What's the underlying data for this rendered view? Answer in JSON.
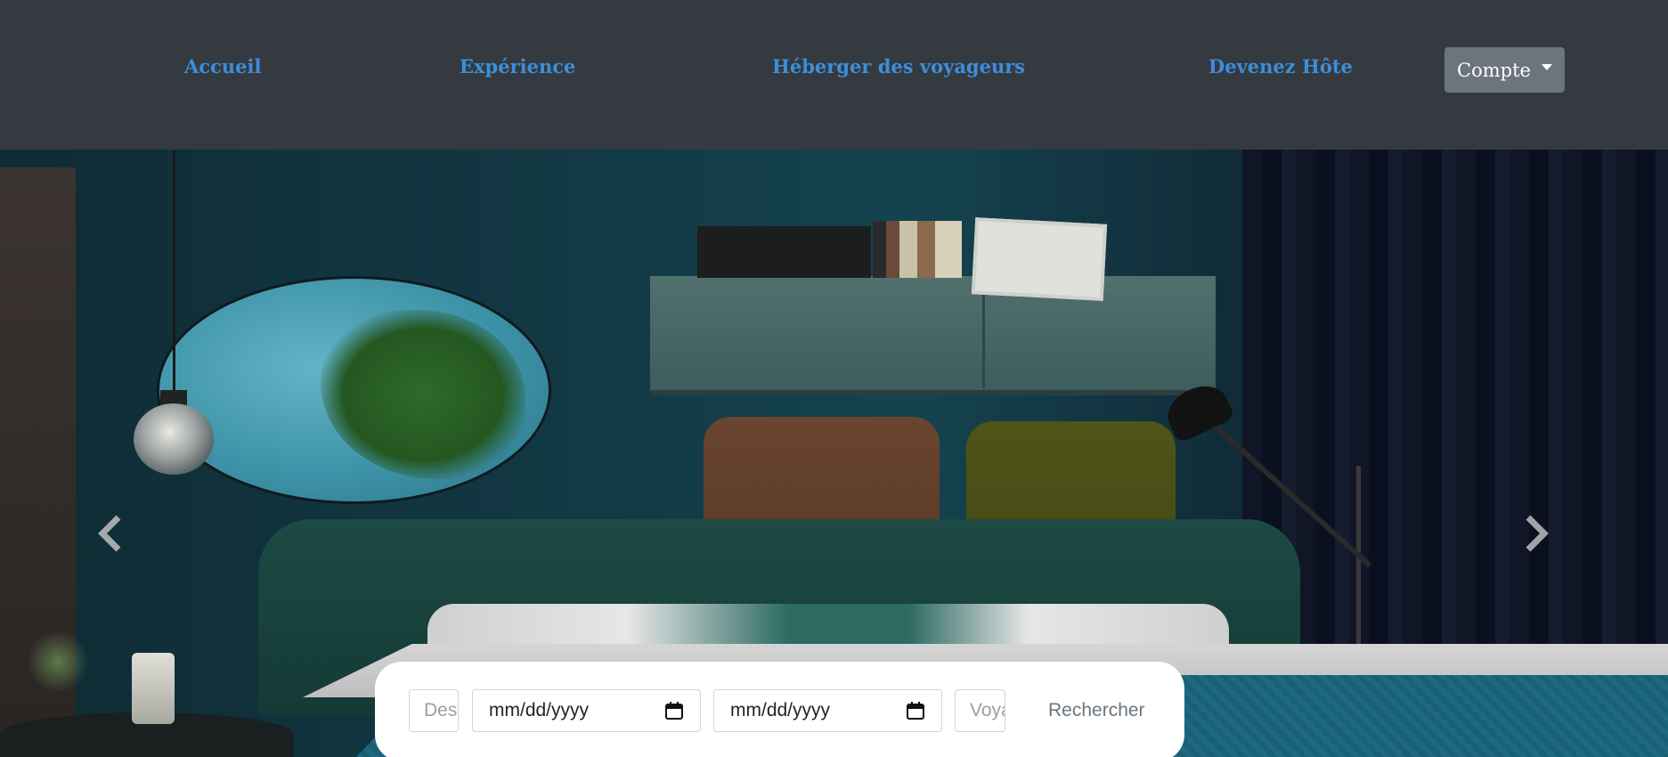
{
  "navbar": {
    "links": [
      {
        "label": "Accueil"
      },
      {
        "label": "Expérience"
      },
      {
        "label": "Héberger des voyageurs"
      },
      {
        "label": "Devenez Hôte"
      }
    ],
    "account_label": "Compte"
  },
  "hero": {
    "carousel": {
      "prev_icon": "chevron-left-icon",
      "next_icon": "chevron-right-icon"
    }
  },
  "search": {
    "destination_placeholder": "Destination",
    "checkin_value": "mm/dd/yyyy",
    "checkout_value": "mm/dd/yyyy",
    "travelers_placeholder": "Voyageurs",
    "submit_label": "Rechercher",
    "calendar_icon": "calendar-icon"
  },
  "colors": {
    "navbar_bg": "#343a40",
    "link": "#3d8ed9",
    "account_button_bg": "#6c757d",
    "search_card_bg": "#ffffff",
    "search_button_text": "#6c757d"
  }
}
